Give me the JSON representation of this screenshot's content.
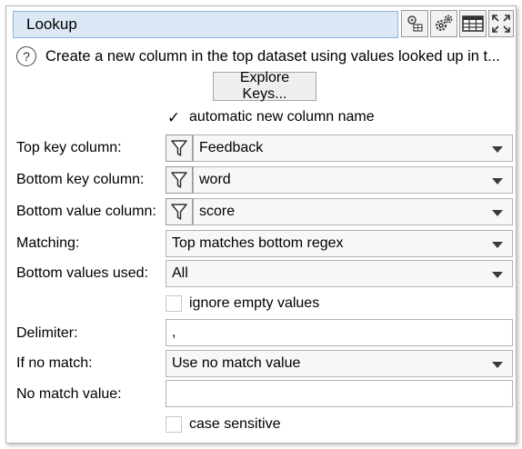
{
  "header": {
    "title": "Lookup"
  },
  "help": {
    "text": "Create a new column in the top dataset using values looked up in t..."
  },
  "explore": {
    "label": "Explore Keys..."
  },
  "options": {
    "auto_name": {
      "label": "automatic new column name",
      "checked": true
    },
    "ignore_empty": {
      "label": "ignore empty values",
      "checked": false
    },
    "case_sensitive": {
      "label": "case sensitive",
      "checked": false
    }
  },
  "fields": {
    "top_key": {
      "label": "Top key column:",
      "value": "Feedback"
    },
    "bottom_key": {
      "label": "Bottom key column:",
      "value": "word"
    },
    "bottom_value": {
      "label": "Bottom value column:",
      "value": "score"
    },
    "matching": {
      "label": "Matching:",
      "value": "Top matches bottom regex"
    },
    "values_used": {
      "label": "Bottom values used:",
      "value": "All"
    },
    "delimiter": {
      "label": "Delimiter:",
      "value": ","
    },
    "if_no_match": {
      "label": "If no match:",
      "value": "Use no match value"
    },
    "no_match_value": {
      "label": "No match value:",
      "value": ""
    }
  },
  "colors": {
    "title_bg": "#dde8f6",
    "title_border": "#8fb2db"
  }
}
